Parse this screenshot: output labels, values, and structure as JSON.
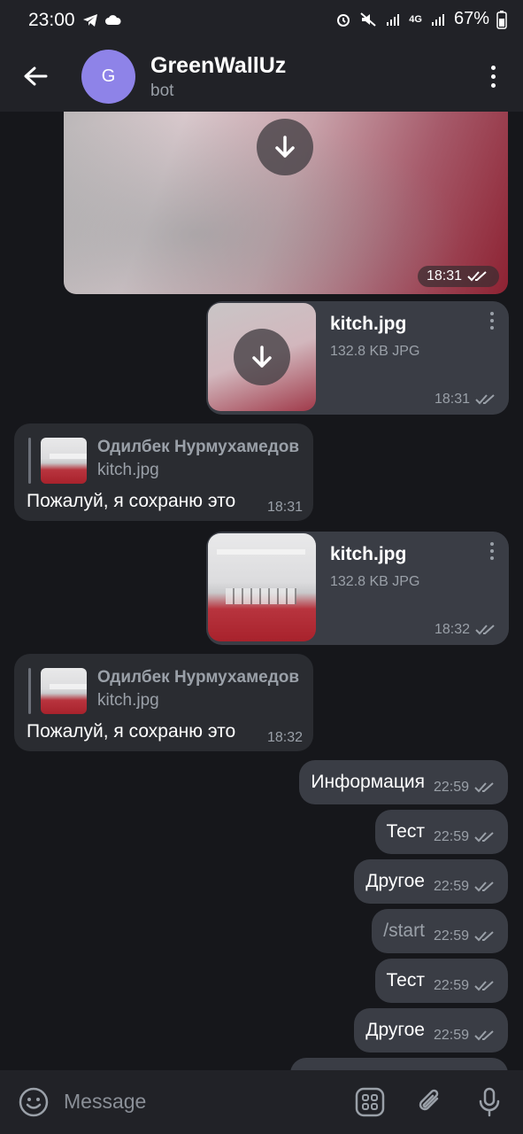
{
  "status_bar": {
    "time": "23:00",
    "network": "4G",
    "battery": "67%",
    "icons": [
      "telegram-icon",
      "cloud-icon",
      "alarm-icon",
      "mute-icon",
      "signal-icon",
      "4g-icon",
      "signal-icon",
      "battery-icon"
    ]
  },
  "header": {
    "avatar_letter": "G",
    "avatar_color": "#8e83e8",
    "title": "GreenWallUz",
    "subtitle": "bot"
  },
  "messages": {
    "photo": {
      "time": "18:31"
    },
    "file1": {
      "name": "kitch.jpg",
      "meta": "132.8 KB JPG",
      "time": "18:31"
    },
    "reply1": {
      "author": "Одилбек Нурмухамедов",
      "file": "kitch.jpg",
      "text": "Пожалуй, я сохраню это",
      "time": "18:31"
    },
    "file2": {
      "name": "kitch.jpg",
      "meta": "132.8 KB JPG",
      "time": "18:32"
    },
    "reply2": {
      "author": "Одилбек Нурмухамедов",
      "file": "kitch.jpg",
      "text": "Пожалуй, я сохраню это",
      "time": "18:32"
    },
    "outgoing": [
      {
        "text": "Информация",
        "time": "22:59"
      },
      {
        "text": "Тест",
        "time": "22:59"
      },
      {
        "text": "Другое",
        "time": "22:59"
      },
      {
        "text": "/start",
        "time": "22:59"
      },
      {
        "text": "Тест",
        "time": "22:59"
      },
      {
        "text": "Другое",
        "time": "22:59"
      }
    ]
  },
  "input": {
    "placeholder": "Message"
  },
  "colors": {
    "background": "#16171b",
    "bar": "#212227",
    "bubble_out": "#3a3d45",
    "bubble_in": "#2a2c31",
    "muted": "#9aa0a8"
  }
}
